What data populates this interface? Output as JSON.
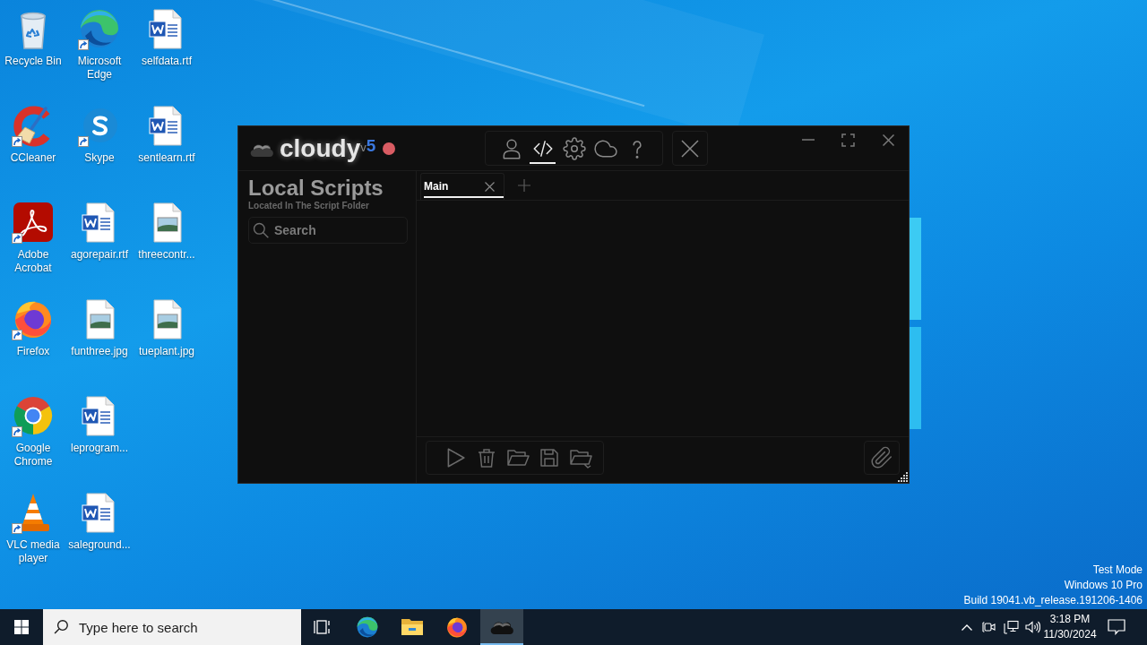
{
  "desktop": {
    "columns": [
      [
        {
          "kind": "recycle-bin",
          "label": "Recycle Bin",
          "shortcut": false
        },
        {
          "kind": "ccleaner",
          "label": "CCleaner",
          "shortcut": true
        },
        {
          "kind": "acrobat",
          "label": "Adobe Acrobat",
          "shortcut": true
        },
        {
          "kind": "firefox",
          "label": "Firefox",
          "shortcut": true
        },
        {
          "kind": "chrome",
          "label": "Google Chrome",
          "shortcut": true
        },
        {
          "kind": "vlc",
          "label": "VLC media player",
          "shortcut": true
        }
      ],
      [
        {
          "kind": "edge",
          "label": "Microsoft Edge",
          "shortcut": true
        },
        {
          "kind": "skype",
          "label": "Skype",
          "shortcut": true
        },
        {
          "kind": "word-document",
          "label": "agorepair.rtf",
          "shortcut": false
        },
        {
          "kind": "image-file",
          "label": "funthree.jpg",
          "shortcut": false
        },
        {
          "kind": "word-document",
          "label": "leprogram...",
          "shortcut": false
        },
        {
          "kind": "word-document",
          "label": "saleground...",
          "shortcut": false
        }
      ],
      [
        {
          "kind": "word-document",
          "label": "selfdata.rtf",
          "shortcut": false
        },
        {
          "kind": "word-document",
          "label": "sentlearn.rtf",
          "shortcut": false
        },
        {
          "kind": "image-file",
          "label": "threecontr...",
          "shortcut": false
        },
        {
          "kind": "image-file",
          "label": "tueplant.jpg",
          "shortcut": false
        }
      ]
    ]
  },
  "app_window": {
    "logo": {
      "name": "cloudy",
      "version_prefix": "v",
      "version": "5"
    },
    "toolbar": [
      {
        "kind": "user",
        "selected": false
      },
      {
        "kind": "code",
        "selected": true
      },
      {
        "kind": "settings",
        "selected": false
      },
      {
        "kind": "cloud",
        "selected": false
      },
      {
        "kind": "help",
        "selected": false
      }
    ],
    "sidebar": {
      "title": "Local Scripts",
      "subtitle": "Located In The Script Folder",
      "search": {
        "placeholder": "Search"
      }
    },
    "tabs": [
      {
        "label": "Main",
        "selected": true
      }
    ]
  },
  "system_notice": [
    "Test Mode",
    "Windows 10 Pro",
    "Build 19041.vb_release.191206-1406"
  ],
  "taskbar": {
    "search": {
      "placeholder": "Type here to search"
    },
    "apps": [
      {
        "kind": "task-view",
        "selected": false
      },
      {
        "kind": "edge",
        "selected": false
      },
      {
        "kind": "file-explorer",
        "selected": false
      },
      {
        "kind": "firefox",
        "selected": false
      },
      {
        "kind": "cloudy",
        "selected": true
      }
    ],
    "clock": {
      "time": "3:18 PM",
      "date": "11/30/2024"
    }
  }
}
